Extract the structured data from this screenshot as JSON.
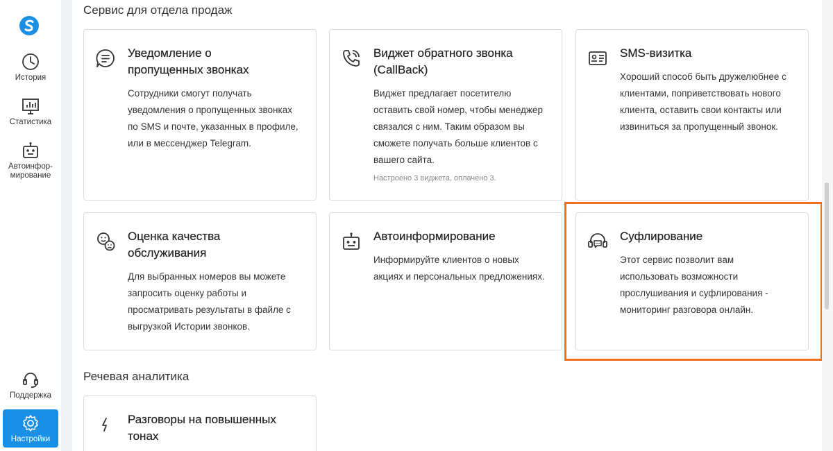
{
  "sidebar": {
    "items": [
      {
        "label": "История",
        "icon": "clock-icon"
      },
      {
        "label": "Статистика",
        "icon": "chart-icon"
      },
      {
        "label": "Автоинфор-мирование",
        "icon": "robot-icon"
      },
      {
        "label": "Поддержка",
        "icon": "headset-icon"
      },
      {
        "label": "Настройки",
        "icon": "gear-icon",
        "active": true
      }
    ]
  },
  "sections": {
    "sales_title": "Сервис для отдела продаж",
    "speech_title": "Речевая аналитика"
  },
  "cards": {
    "missed_calls": {
      "title": "Уведомление о пропущенных звонках",
      "description": "Сотрудники смогут получать уведомления о пропущенных звонках по SMS и почте, указанных в профиле, или в мессенджер Telegram."
    },
    "callback": {
      "title": "Виджет обратного звонка (CallBack)",
      "description": "Виджет предлагает посетителю оставить свой номер, чтобы менеджер связался с ним. Таким образом вы сможете получать больше клиентов с вашего сайта.",
      "note": "Настроено 3 виджета, оплачено 3."
    },
    "sms_card": {
      "title": "SMS-визитка",
      "description": "Хороший способ быть дружелюбнее с клиентами, поприветствовать нового клиента, оставить свои контакты или извиниться за пропущенный звонок."
    },
    "quality": {
      "title": "Оценка качества обслуживания",
      "description": "Для выбранных номеров вы можете запросить оценку работы и просматривать результаты в файле с выгрузкой Истории звонков."
    },
    "autoinform": {
      "title": "Автоинформирование",
      "description": "Информируйте клиентов о новых акциях и персональных предложениях."
    },
    "prompting": {
      "title": "Суфлирование",
      "description": "Этот сервис позволит вам использовать возможности прослушивания и суфлирования - мониторинг разговора онлайн."
    },
    "raised_tones": {
      "title": "Разговоры на повышенных тонах"
    }
  },
  "colors": {
    "accent": "#1a8fe6",
    "highlight": "#f07020"
  }
}
